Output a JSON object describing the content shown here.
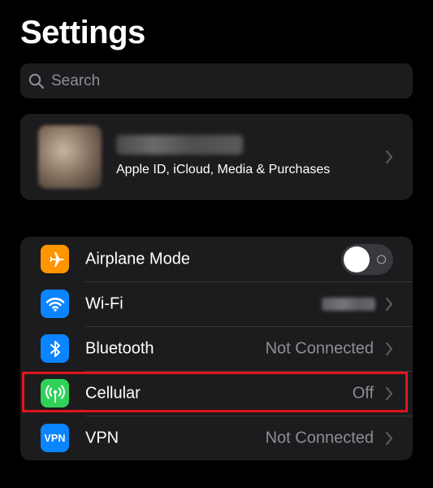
{
  "header": {
    "title": "Settings"
  },
  "search": {
    "placeholder": "Search"
  },
  "profile": {
    "subtitle": "Apple ID, iCloud, Media & Purchases"
  },
  "settings": {
    "rows": [
      {
        "label": "Airplane Mode",
        "icon": "airplane-icon",
        "icon_color": "#ff9500",
        "toggle_on": false
      },
      {
        "label": "Wi-Fi",
        "icon": "wifi-icon",
        "icon_color": "#0a84ff"
      },
      {
        "label": "Bluetooth",
        "icon": "bluetooth-icon",
        "icon_color": "#0a84ff",
        "value": "Not Connected"
      },
      {
        "label": "Cellular",
        "icon": "cellular-antenna-icon",
        "icon_color": "#30d158",
        "value": "Off",
        "highlighted": true,
        "highlight_color": "#e0151f"
      },
      {
        "label": "VPN",
        "icon": "vpn-icon",
        "icon_color": "#0a84ff",
        "icon_text": "VPN",
        "value": "Not Connected"
      }
    ]
  }
}
